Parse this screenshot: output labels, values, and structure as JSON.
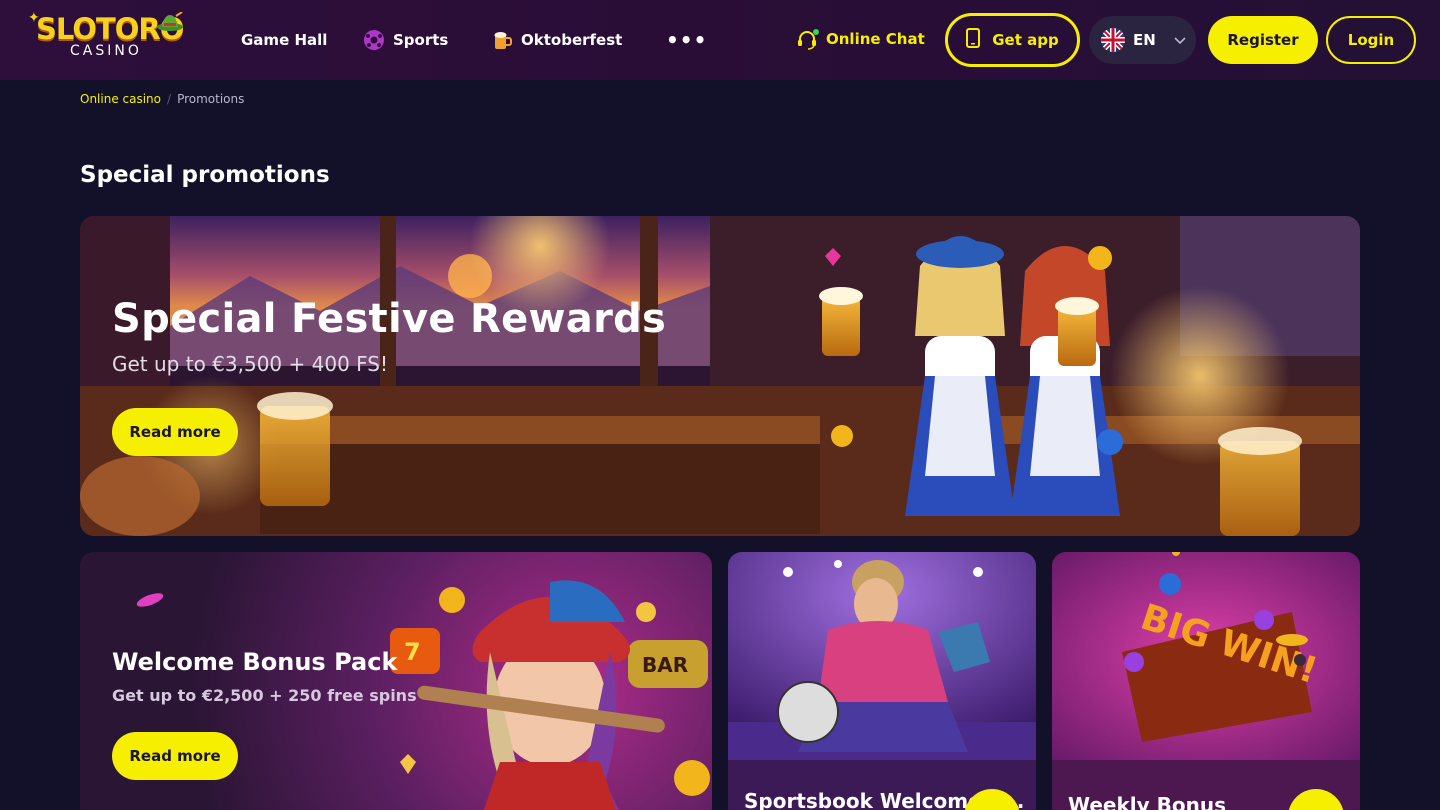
{
  "header": {
    "logo": {
      "name": "SLOTORO",
      "sub": "CASINO"
    },
    "nav": [
      {
        "label": "Game Hall",
        "icon": "none"
      },
      {
        "label": "Sports",
        "icon": "soccer-ball-icon"
      },
      {
        "label": "Oktoberfest",
        "icon": "beer-mug-icon"
      }
    ],
    "more_label": "•••",
    "chat_label": "Online Chat",
    "get_app_label": "Get app",
    "language": "EN",
    "register_label": "Register",
    "login_label": "Login"
  },
  "breadcrumb": {
    "home": "Online casino",
    "separator": "/",
    "current": "Promotions"
  },
  "section_title": "Special promotions",
  "hero": {
    "title": "Special Festive Rewards",
    "subtitle": "Get up to €3,500 + 400 FS!",
    "button": "Read more"
  },
  "cards": {
    "welcome": {
      "title": "Welcome Bonus Pack",
      "subtitle": "Get up to €2,500 + 250 free spins",
      "button": "Read more"
    },
    "sports": {
      "title": "Sportsbook Welcome B…"
    },
    "weekly": {
      "title": "Weekly Bonus"
    }
  },
  "colors": {
    "accent": "#f6f000",
    "background": "#13112a",
    "header": "#2e0f3c"
  }
}
